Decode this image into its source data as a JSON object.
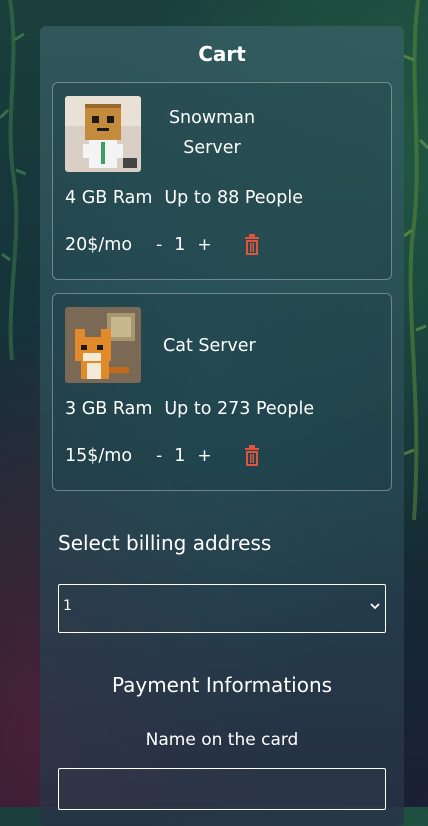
{
  "page_title": "Cart",
  "items": [
    {
      "name_line1": "Snowman",
      "name_line2": "Server",
      "ram": "4 GB Ram",
      "capacity": "Up to 88 People",
      "price": "20$/mo",
      "quantity": "1",
      "minus_label": "-",
      "plus_label": "+",
      "image": "snowman-server-pixel-art"
    },
    {
      "name_line1": "Cat Server",
      "name_line2": "",
      "ram": "3 GB Ram",
      "capacity": "Up to 273 People",
      "price": "15$/mo",
      "quantity": "1",
      "minus_label": "-",
      "plus_label": "+",
      "image": "cat-server-pixel-art"
    }
  ],
  "billing": {
    "title": "Select billing address",
    "selected": "1"
  },
  "payment": {
    "title": "Payment Informations",
    "name_label": "Name on the card",
    "name_value": ""
  },
  "colors": {
    "trash": "#e0533c",
    "text": "#ffffff"
  },
  "icons": {
    "trash": "trash-icon",
    "chevron": "chevron-down-icon"
  }
}
